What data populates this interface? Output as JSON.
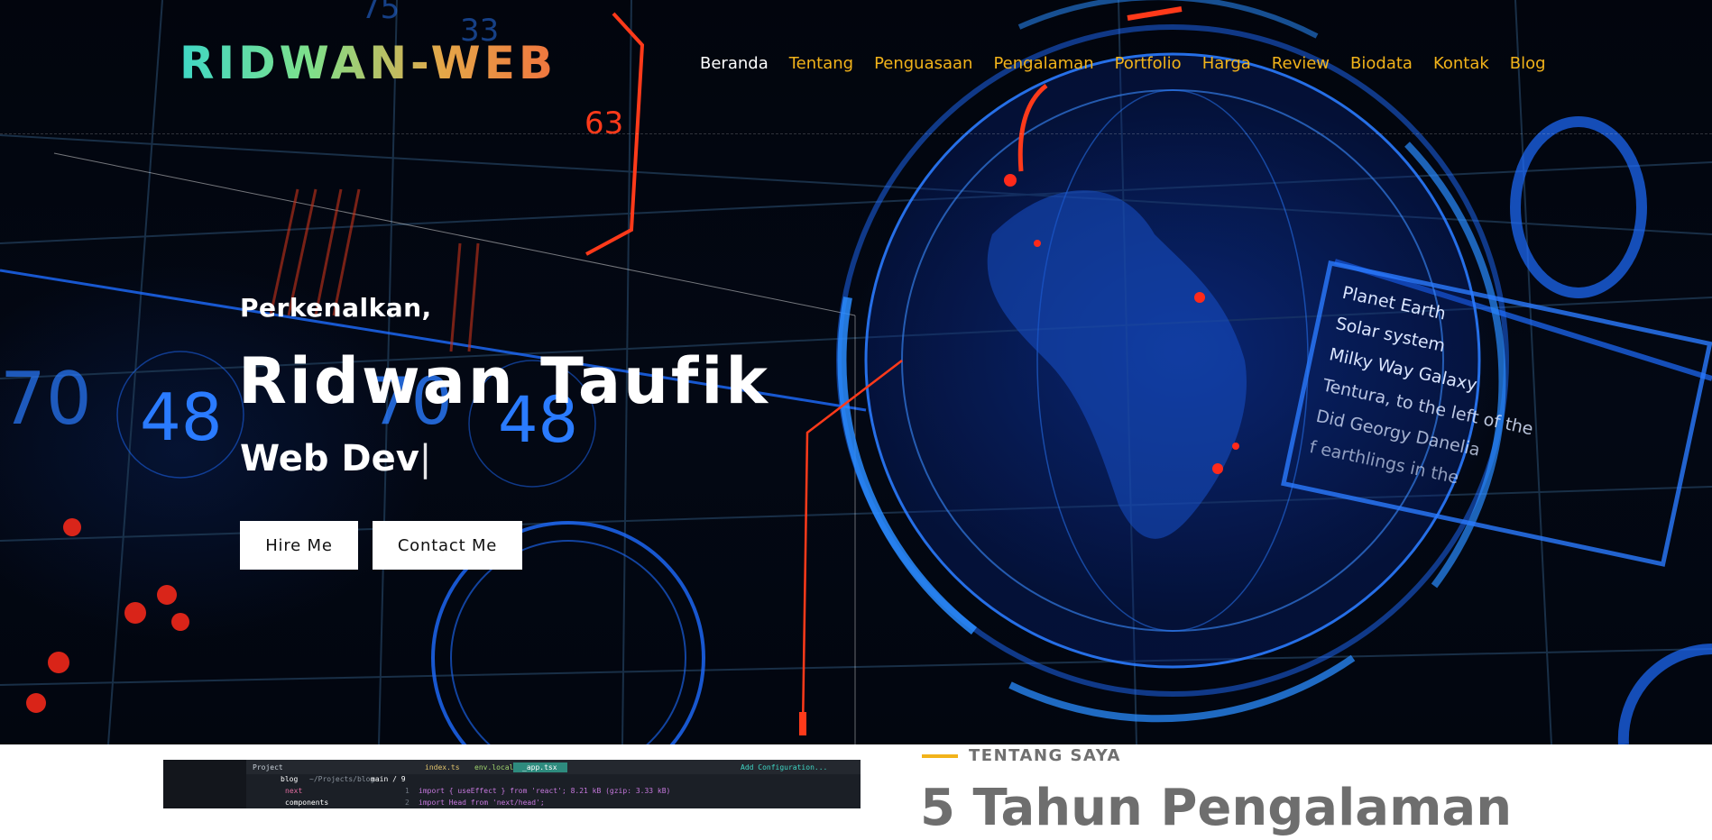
{
  "site": {
    "logo": "RIDWAN-WEB"
  },
  "nav": {
    "items": [
      {
        "label": "Beranda",
        "active": true
      },
      {
        "label": "Tentang",
        "active": false
      },
      {
        "label": "Penguasaan",
        "active": false
      },
      {
        "label": "Pengalaman",
        "active": false
      },
      {
        "label": "Portfolio",
        "active": false
      },
      {
        "label": "Harga",
        "active": false
      },
      {
        "label": "Review",
        "active": false
      },
      {
        "label": "Biodata",
        "active": false
      },
      {
        "label": "Kontak",
        "active": false
      },
      {
        "label": "Blog",
        "active": false
      }
    ]
  },
  "hero": {
    "greeting": "Perkenalkan,",
    "name": "Ridwan Taufik",
    "role": "Web Dev",
    "hire_label": "Hire Me",
    "contact_label": "Contact Me",
    "hud_texts": {
      "panel_lines": [
        "Planet Earth",
        "Solar system",
        "Milky Way Galaxy",
        "Tentura, to the left of the",
        "Did Georgy Danelia",
        "f earthlings in the"
      ],
      "numbers": [
        "48",
        "70",
        "48",
        "70",
        "63",
        "75",
        "33"
      ]
    }
  },
  "about": {
    "eyebrow": "TENTANG SAYA",
    "title": "5 Tahun Pengalaman"
  },
  "code_preview": {
    "project_label": "Project",
    "folder": "blog",
    "path": "~/Projects/blog",
    "branch": "main / 9",
    "tabs": [
      "index.ts",
      "env.local",
      "_app.tsx"
    ],
    "tree": [
      "next",
      "components"
    ],
    "lines": [
      "import { useEffect } from 'react';  8.21 kB (gzip: 3.33 kB)",
      "import Head from 'next/head';"
    ],
    "add_config": "Add Configuration..."
  },
  "colors": {
    "accent": "#f2b31a",
    "nav_active": "#ffffff",
    "hero_bg": "#02050d",
    "hud_blue": "#1e6cff",
    "hud_red": "#ff2a1a"
  }
}
